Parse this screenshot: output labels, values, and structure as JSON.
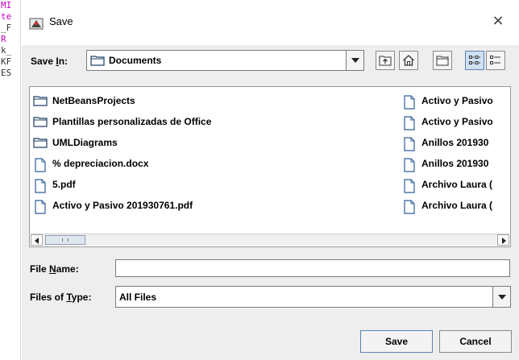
{
  "background_editor": {
    "lines": [
      "MI",
      "te",
      "_F",
      "R",
      "k_",
      "KF",
      "ES"
    ]
  },
  "dialog": {
    "title": "Save",
    "close_glyph": "×"
  },
  "save_in": {
    "label_pre": "Save ",
    "label_mnemonic": "I",
    "label_post": "n:",
    "selected": "Documents"
  },
  "toolbar": {
    "buttons": [
      "up-one-level-icon",
      "home-icon",
      "new-folder-icon",
      "list-view-icon",
      "details-view-icon"
    ]
  },
  "files": {
    "column_a": [
      {
        "type": "folder",
        "name": "NetBeansProjects"
      },
      {
        "type": "folder",
        "name": "Plantillas personalizadas de Office"
      },
      {
        "type": "folder",
        "name": "UMLDiagrams"
      },
      {
        "type": "file",
        "name": "% depreciacion.docx"
      },
      {
        "type": "file",
        "name": "5.pdf"
      },
      {
        "type": "file",
        "name": "Activo y Pasivo 201930761.pdf"
      }
    ],
    "column_b": [
      {
        "type": "file",
        "name": "Activo y Pasivo"
      },
      {
        "type": "file",
        "name": "Activo y Pasivo"
      },
      {
        "type": "file",
        "name": "Anillos 201930"
      },
      {
        "type": "file",
        "name": "Anillos 201930"
      },
      {
        "type": "file",
        "name": "Archivo Laura ("
      },
      {
        "type": "file",
        "name": "Archivo Laura ("
      }
    ]
  },
  "file_name": {
    "label_pre": "File ",
    "label_mnemonic": "N",
    "label_post": "ame:",
    "value": ""
  },
  "file_type": {
    "label_pre": "Files of ",
    "label_mnemonic": "T",
    "label_post": "ype:",
    "selected": "All Files"
  },
  "buttons": {
    "save": "Save",
    "cancel": "Cancel"
  },
  "colors": {
    "dialog_bg": "#eeeeee",
    "folder_outline": "#1f3f66",
    "file_outline": "#2f5f9a",
    "selected_toggle": "#cfe0f3"
  }
}
